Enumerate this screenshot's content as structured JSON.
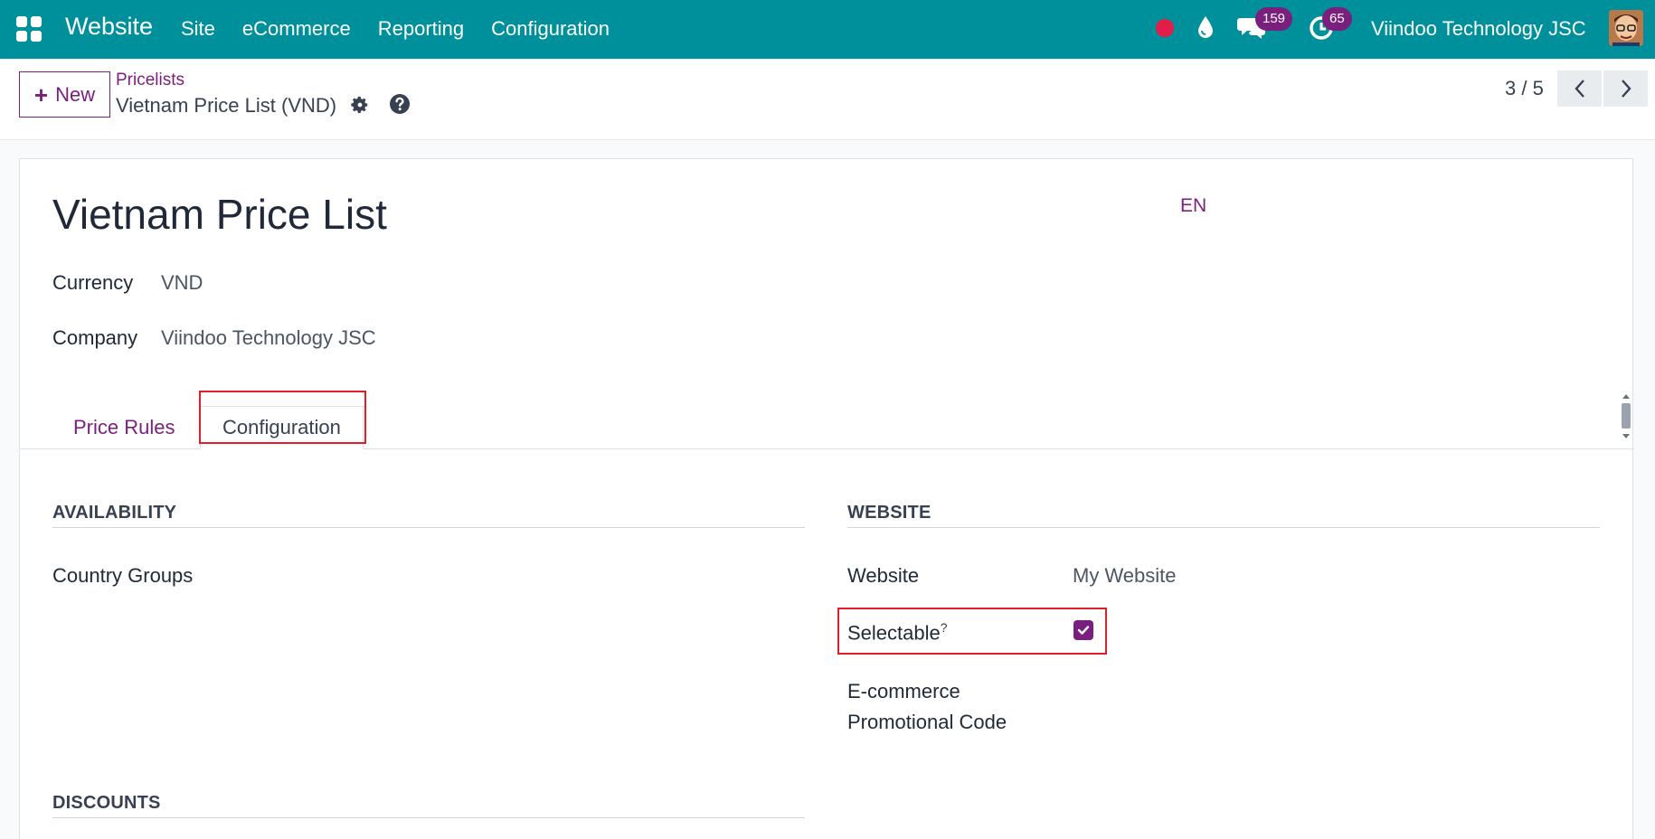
{
  "navbar": {
    "app_name": "Website",
    "menu": [
      "Site",
      "eCommerce",
      "Reporting",
      "Configuration"
    ],
    "messages_count": "159",
    "activities_count": "65",
    "company": "Viindoo Technology JSC",
    "accent_color": "#00909c"
  },
  "control_panel": {
    "new_label": "New",
    "breadcrumb_parent": "Pricelists",
    "breadcrumb_current": "Vietnam Price List (VND)",
    "pager": "3 / 5"
  },
  "form": {
    "title": "Vietnam Price List",
    "lang": "EN",
    "currency_label": "Currency",
    "currency_value": "VND",
    "company_label": "Company",
    "company_value": "Viindoo Technology JSC",
    "tabs": [
      "Price Rules",
      "Configuration"
    ],
    "availability": {
      "heading": "AVAILABILITY",
      "country_groups_label": "Country Groups"
    },
    "website": {
      "heading": "WEBSITE",
      "website_label": "Website",
      "website_value": "My Website",
      "selectable_label": "Selectable",
      "selectable_tip": "?",
      "selectable_checked": true,
      "promo_label_line1": "E-commerce",
      "promo_label_line2": "Promotional Code"
    },
    "discounts": {
      "heading": "DISCOUNTS"
    },
    "highlight_color": "#e11d2a",
    "brand_color": "#7b1f7e"
  }
}
